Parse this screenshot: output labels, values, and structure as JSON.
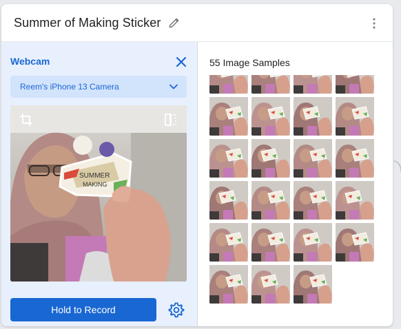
{
  "card": {
    "title": "Summer of Making Sticker"
  },
  "webcam": {
    "label": "Webcam",
    "camera_selected": "Reem's iPhone 13 Camera",
    "record_button": "Hold to Record"
  },
  "samples": {
    "title": "55 Image Samples",
    "count": 55,
    "visible_thumbnails": 23
  },
  "colors": {
    "accent": "#1967d2",
    "panel_bg": "#e8f0fe",
    "select_bg": "#d2e3fc"
  },
  "icons": {
    "edit": "pencil-icon",
    "more": "kebab-menu-icon",
    "close": "close-icon",
    "dropdown": "chevron-down-icon",
    "crop": "crop-icon",
    "flip": "flip-icon",
    "settings": "gear-icon"
  }
}
